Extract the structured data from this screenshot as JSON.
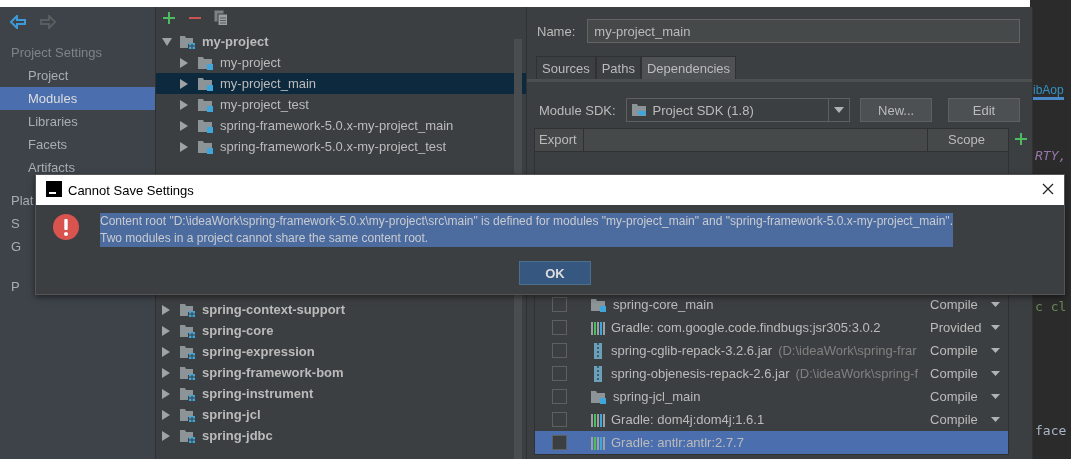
{
  "sidebar": {
    "section": "Project Settings",
    "items": [
      {
        "label": "Project",
        "selected": false
      },
      {
        "label": "Modules",
        "selected": true
      },
      {
        "label": "Libraries",
        "selected": false
      },
      {
        "label": "Facets",
        "selected": false
      },
      {
        "label": "Artifacts",
        "selected": false
      }
    ],
    "fragments": [
      "Plat",
      "S",
      "G",
      "P"
    ]
  },
  "tree": {
    "top": [
      {
        "label": "my-project",
        "expanded": true,
        "kind": "project",
        "children": [
          {
            "label": "my-project",
            "selected": false
          },
          {
            "label": "my-project_main",
            "selected": true
          },
          {
            "label": "my-project_test",
            "selected": false
          },
          {
            "label": "spring-framework-5.0.x-my-project_main",
            "selected": false
          },
          {
            "label": "spring-framework-5.0.x-my-project_test",
            "selected": false
          }
        ]
      }
    ],
    "bottom": [
      {
        "label": "spring-context-support",
        "selected": false
      },
      {
        "label": "spring-core",
        "selected": false
      },
      {
        "label": "spring-expression",
        "selected": false
      },
      {
        "label": "spring-framework-bom",
        "selected": false
      },
      {
        "label": "spring-instrument",
        "selected": false
      },
      {
        "label": "spring-jcl",
        "selected": false
      },
      {
        "label": "spring-jdbc",
        "selected": false
      }
    ]
  },
  "module": {
    "name_label": "Name:",
    "name": "my-project_main",
    "tabs": [
      {
        "label": "Sources",
        "selected": false
      },
      {
        "label": "Paths",
        "selected": false
      },
      {
        "label": "Dependencies",
        "selected": true
      }
    ],
    "sdk_label": "Module SDK:",
    "sdk": "Project SDK (1.8)",
    "buttons": [
      "New...",
      "Edit"
    ],
    "columns": [
      "Export",
      "Scope"
    ],
    "dependencies": [
      {
        "kind": "module",
        "name": "spring-core_main",
        "scope": "Compile",
        "exported": false,
        "selected": false
      },
      {
        "kind": "library",
        "name": "Gradle: com.google.code.findbugs:jsr305:3.0.2",
        "scope": "Provided",
        "exported": false,
        "selected": false
      },
      {
        "kind": "jar",
        "name": "spring-cglib-repack-3.2.6.jar",
        "detail": "(D:\\ideaWork\\spring-frar",
        "scope": "Compile",
        "exported": false,
        "selected": false
      },
      {
        "kind": "jar",
        "name": "spring-objenesis-repack-2.6.jar",
        "detail": "(D:\\ideaWork\\spring-f",
        "scope": "Compile",
        "exported": false,
        "selected": false
      },
      {
        "kind": "module",
        "name": "spring-jcl_main",
        "scope": "Compile",
        "exported": false,
        "selected": false
      },
      {
        "kind": "library",
        "name": "Gradle: dom4j:dom4j:1.6.1",
        "scope": "Compile",
        "exported": false,
        "selected": false
      },
      {
        "kind": "library",
        "name": "Gradle: antlr:antlr:2.7.7",
        "exported": false,
        "selected": true
      }
    ]
  },
  "editor": {
    "tab": "ibAop",
    "fragments": [
      "RTY,",
      "c cl",
      "face"
    ]
  },
  "dialog": {
    "title": "Cannot Save Settings",
    "message": "Content root \"D:\\ideaWork\\spring-framework-5.0.x\\my-project\\src\\main\" is defined for modules \"my-project_main\" and \"spring-framework-5.0.x-my-project_main\".\nTwo modules in a project cannot share the same content root.",
    "button": "OK"
  }
}
